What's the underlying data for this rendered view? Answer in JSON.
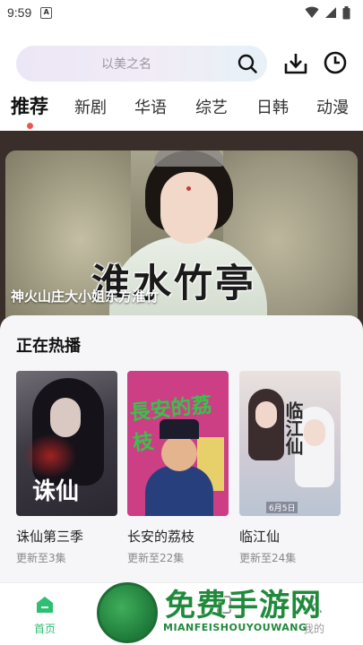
{
  "status_bar": {
    "time": "9:59",
    "notification_letter": "A"
  },
  "search": {
    "placeholder": "以美之名"
  },
  "tabs": [
    {
      "label": "推荐",
      "active": true
    },
    {
      "label": "新剧",
      "active": false
    },
    {
      "label": "华语",
      "active": false
    },
    {
      "label": "综艺",
      "active": false
    },
    {
      "label": "日韩",
      "active": false
    },
    {
      "label": "动漫",
      "active": false
    }
  ],
  "banner": {
    "title_art": "淮水竹亭",
    "caption": "神火山庄大小姐东方淮竹"
  },
  "hot": {
    "title": "正在热播",
    "items": [
      {
        "title": "诛仙第三季",
        "subtitle": "更新至3集",
        "poster_text": "诛仙"
      },
      {
        "title": "长安的荔枝",
        "subtitle": "更新至22集",
        "poster_text": "長安的荔枝"
      },
      {
        "title": "临江仙",
        "subtitle": "更新至24集",
        "poster_text": "临江仙",
        "poster_date": "6月5日"
      }
    ]
  },
  "bottom_nav": [
    {
      "label": "首页",
      "active": true,
      "icon": "home-icon"
    },
    {
      "label": "",
      "active": false,
      "icon": "channel-icon"
    },
    {
      "label": "",
      "active": false,
      "icon": "shorts-icon"
    },
    {
      "label": "我的",
      "active": false,
      "icon": "profile-icon"
    }
  ],
  "watermark": {
    "text": "免费手游网",
    "sub": "MIANFEISHOUYOUWANG"
  },
  "colors": {
    "accent": "#2fbf73",
    "tab_dot": "#e8594f",
    "panel_bg": "#f6f6f8"
  }
}
